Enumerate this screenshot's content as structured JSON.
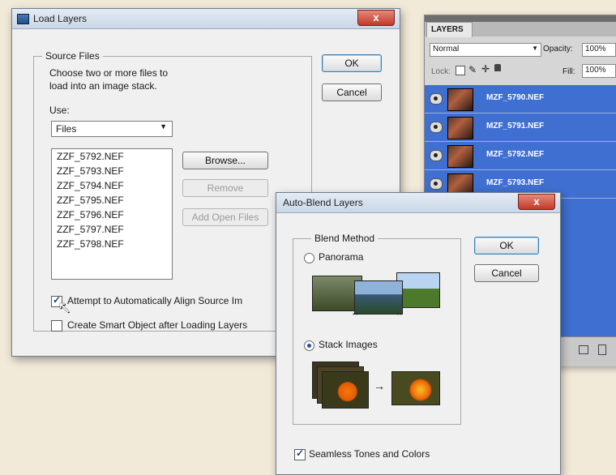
{
  "load_layers": {
    "title": "Load Layers",
    "close_label": "x",
    "source_files_legend": "Source Files",
    "description_line1": "Choose two or more files to",
    "description_line2": "load into an image stack.",
    "use_label": "Use:",
    "use_value": "Files",
    "files": [
      "ZZF_5792.NEF",
      "ZZF_5793.NEF",
      "ZZF_5794.NEF",
      "ZZF_5795.NEF",
      "ZZF_5796.NEF",
      "ZZF_5797.NEF",
      "ZZF_5798.NEF"
    ],
    "browse_label": "Browse...",
    "remove_label": "Remove",
    "add_open_files_label": "Add Open Files",
    "ok_label": "OK",
    "cancel_label": "Cancel",
    "align_label": "Attempt to Automatically Align Source Im",
    "align_checked": true,
    "smart_object_label": "Create Smart Object after Loading Layers",
    "smart_object_checked": false
  },
  "layers_panel": {
    "tab_label": "LAYERS",
    "blend_mode": "Normal",
    "opacity_label": "Opacity:",
    "opacity_value": "100%",
    "lock_label": "Lock:",
    "fill_label": "Fill:",
    "fill_value": "100%",
    "layers": [
      "MZF_5790.NEF",
      "MZF_5791.NEF",
      "MZF_5792.NEF",
      "MZF_5793.NEF"
    ]
  },
  "auto_blend": {
    "title": "Auto-Blend Layers",
    "close_label": "x",
    "blend_method_legend": "Blend Method",
    "panorama_label": "Panorama",
    "stack_images_label": "Stack Images",
    "selected_method": "Stack Images",
    "ok_label": "OK",
    "cancel_label": "Cancel",
    "seamless_label": "Seamless Tones and Colors",
    "seamless_checked": true
  }
}
